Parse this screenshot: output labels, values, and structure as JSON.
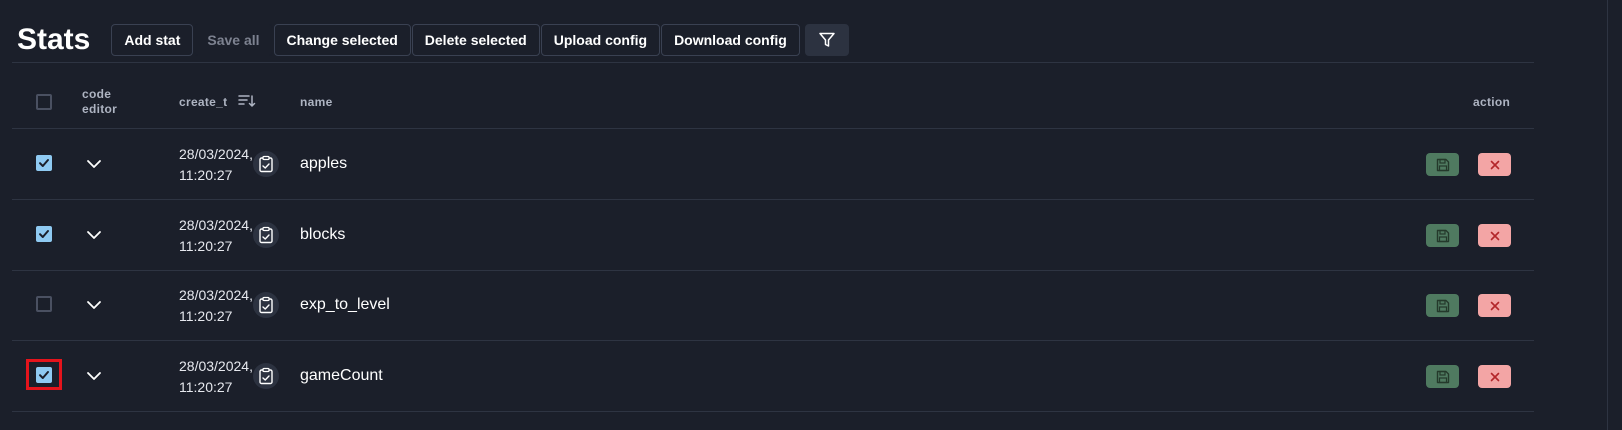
{
  "header": {
    "title": "Stats",
    "buttons": {
      "add_stat": "Add stat",
      "save_all": "Save all",
      "change_selected": "Change selected",
      "delete_selected": "Delete selected",
      "upload_config": "Upload config",
      "download_config": "Download config"
    },
    "filter_icon": "filter-icon"
  },
  "table": {
    "columns": {
      "code_editor_line1": "code",
      "code_editor_line2": "editor",
      "create_t": "create_t",
      "name": "name",
      "action": "action"
    },
    "rows": [
      {
        "checked": true,
        "date_line1": "28/03/2024,",
        "date_line2": "11:20:27",
        "name": "apples"
      },
      {
        "checked": true,
        "date_line1": "28/03/2024,",
        "date_line2": "11:20:27",
        "name": "blocks"
      },
      {
        "checked": false,
        "date_line1": "28/03/2024,",
        "date_line2": "11:20:27",
        "name": "exp_to_level"
      },
      {
        "checked": true,
        "date_line1": "28/03/2024,",
        "date_line2": "11:20:27",
        "name": "gameCount",
        "focused": true
      }
    ]
  },
  "colors": {
    "background": "#1b1f2a",
    "checkbox_checked": "#8fcaf2",
    "save_button": "#4f7a60",
    "delete_button": "#f3a5a5",
    "focus_ring": "#e5141c"
  }
}
